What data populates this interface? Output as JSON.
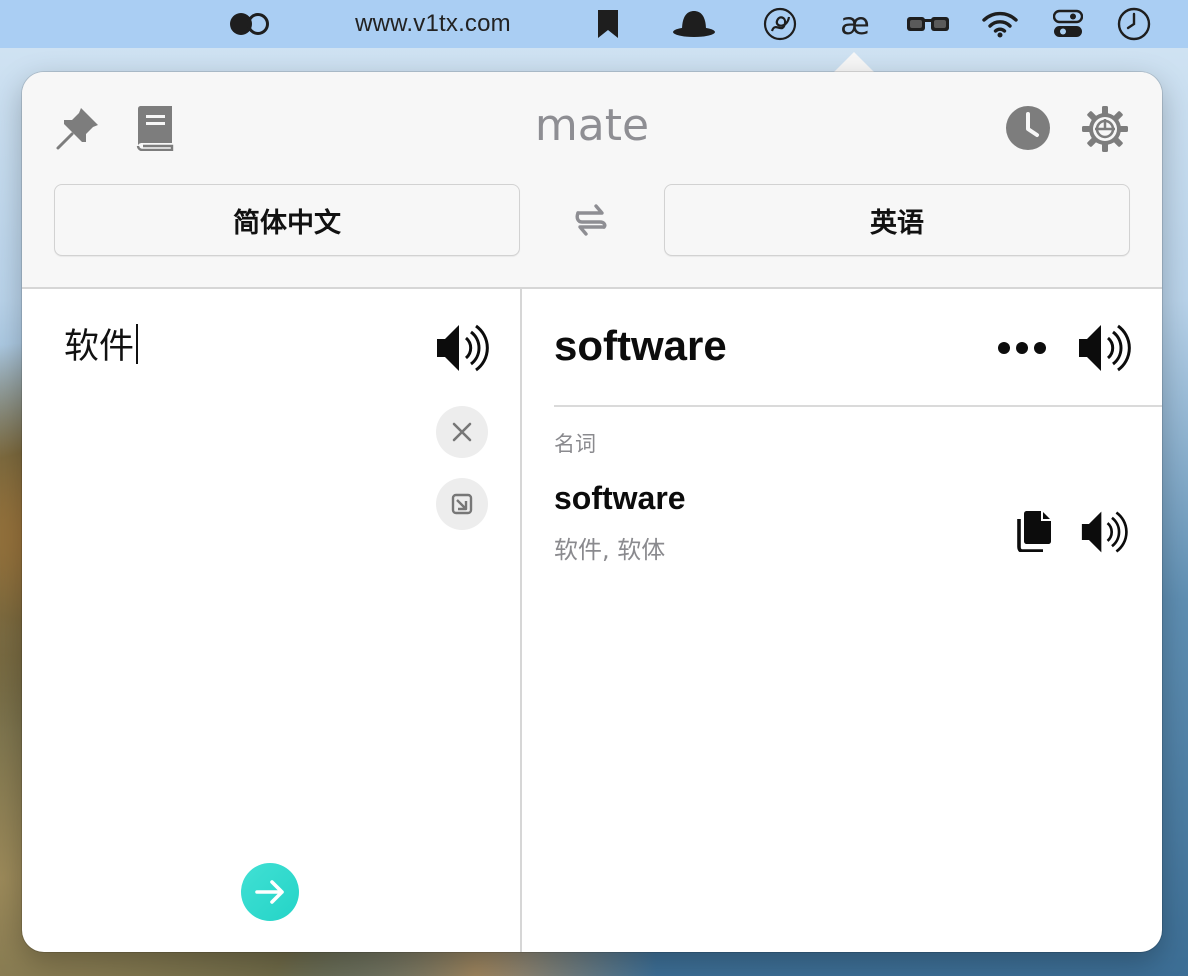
{
  "menubar": {
    "url": "www.v1tx.com",
    "ae_glyph": "æ",
    "icons": [
      "toggle-half-icon",
      "bookmark-icon",
      "bowler-hat-icon",
      "scribble-icon",
      "ae-icon",
      "glasses-icon",
      "wifi-icon",
      "control-center-icon",
      "clock-icon"
    ]
  },
  "app": {
    "title": "mate",
    "header_icons": [
      "pin-icon",
      "book-icon",
      "history-icon",
      "settings-gear-icon"
    ]
  },
  "languages": {
    "source": "简体中文",
    "target": "英语",
    "swap_icon": "swap-arrows-icon"
  },
  "input": {
    "text": "软件",
    "icons": [
      "speaker-icon",
      "clear-icon",
      "collapse-icon",
      "translate-arrow-icon"
    ]
  },
  "result": {
    "word": "software",
    "icons": [
      "more-icon",
      "speaker-icon"
    ],
    "entries": [
      {
        "part_of_speech": "名词",
        "word": "software",
        "translation": "软件, 软体",
        "icons": [
          "copy-icon",
          "speaker-icon"
        ]
      }
    ]
  },
  "colors": {
    "accent_gradient_start": "#41e0d4",
    "accent_gradient_end": "#24d4c7",
    "menubar": "#aacef3",
    "secondary_text": "#8a8a8e"
  }
}
